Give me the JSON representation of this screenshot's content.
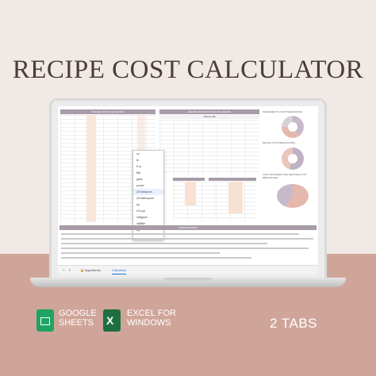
{
  "title": "RECIPE COST CALCULATOR",
  "spreadsheet": {
    "left_header": "RECIPE COST CALCULATOR",
    "center_header": "RECIPE DESCRIPTION & THE RECIPE",
    "center_sub": "APPLE PIE",
    "right_chart1": "INGREDIENTS COST BREAKDOWN",
    "right_chart2": "RECIPE COST BREAKDOWN",
    "right_chart3": "COST INCURRED PER SERVING/COST BREAKDOWN",
    "instructions_header": "INSTRUCTIONS",
    "dropdown_options": [
      "oz",
      "lb",
      "fl oz",
      "liter",
      "gram",
      "pound",
      "US teaspoon",
      "US tablespoon",
      "kg",
      "US cup",
      "milligram",
      "milliliter",
      "kg"
    ],
    "tabs": [
      "Ingredients",
      "Calculator"
    ]
  },
  "brands": {
    "google_line1": "GOOGLE",
    "google_line2": "SHEETS",
    "excel_line1": "EXCEL FOR",
    "excel_line2": "WINDOWS",
    "tabs_count": "2 TABS"
  },
  "colors": {
    "accent": "#a89ca8",
    "peach": "#f7e1d3",
    "bg_pink": "#cfa59a",
    "google_green": "#1fa463",
    "excel_green": "#1d6f42"
  }
}
